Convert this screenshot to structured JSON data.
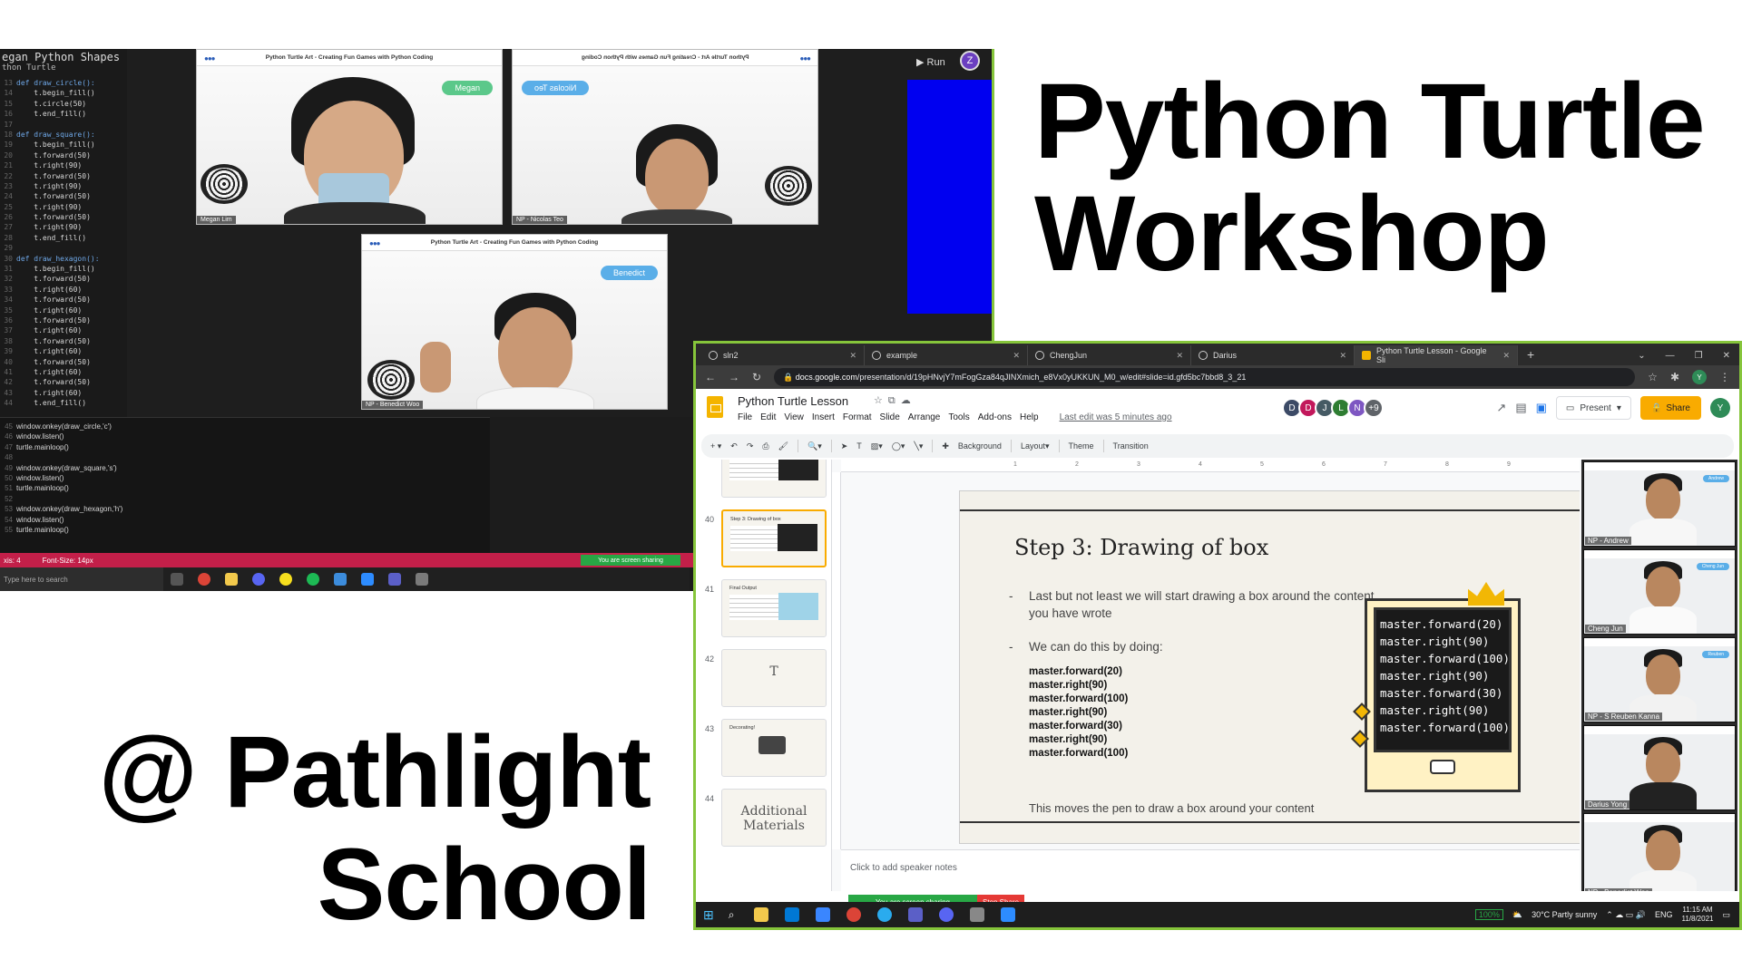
{
  "titles": {
    "main_line1": "Python Turtle",
    "main_line2": "Workshop",
    "location_line1": "@ Pathlight",
    "location_line2": "School"
  },
  "editor": {
    "file_title": "egan Python Shapes",
    "subtitle": "thon Turtle",
    "lines": [
      {
        "n": "13",
        "t": "def draw_circle():",
        "kw": true
      },
      {
        "n": "14",
        "t": "    t.begin_fill()"
      },
      {
        "n": "15",
        "t": "    t.circle(50)"
      },
      {
        "n": "16",
        "t": "    t.end_fill()"
      },
      {
        "n": "17",
        "t": ""
      },
      {
        "n": "18",
        "t": "def draw_square():",
        "kw": true
      },
      {
        "n": "19",
        "t": "    t.begin_fill()"
      },
      {
        "n": "20",
        "t": "    t.forward(50)"
      },
      {
        "n": "21",
        "t": "    t.right(90)"
      },
      {
        "n": "22",
        "t": "    t.forward(50)"
      },
      {
        "n": "23",
        "t": "    t.right(90)"
      },
      {
        "n": "24",
        "t": "    t.forward(50)"
      },
      {
        "n": "25",
        "t": "    t.right(90)"
      },
      {
        "n": "26",
        "t": "    t.forward(50)"
      },
      {
        "n": "27",
        "t": "    t.right(90)"
      },
      {
        "n": "28",
        "t": "    t.end_fill()"
      },
      {
        "n": "29",
        "t": ""
      },
      {
        "n": "30",
        "t": "def draw_hexagon():",
        "kw": true
      },
      {
        "n": "31",
        "t": "    t.begin_fill()"
      },
      {
        "n": "32",
        "t": "    t.forward(50)"
      },
      {
        "n": "33",
        "t": "    t.right(60)"
      },
      {
        "n": "34",
        "t": "    t.forward(50)"
      },
      {
        "n": "35",
        "t": "    t.right(60)"
      },
      {
        "n": "36",
        "t": "    t.forward(50)"
      },
      {
        "n": "37",
        "t": "    t.right(60)"
      },
      {
        "n": "38",
        "t": "    t.forward(50)"
      },
      {
        "n": "39",
        "t": "    t.right(60)"
      },
      {
        "n": "40",
        "t": "    t.forward(50)"
      },
      {
        "n": "41",
        "t": "    t.right(60)"
      },
      {
        "n": "42",
        "t": "    t.forward(50)"
      },
      {
        "n": "43",
        "t": "    t.right(60)"
      },
      {
        "n": "44",
        "t": "    t.end_fill()"
      }
    ],
    "lower_lines": [
      {
        "n": "45",
        "t": "window.onkey(draw_circle,'c')"
      },
      {
        "n": "46",
        "t": "window.listen()"
      },
      {
        "n": "47",
        "t": "turtle.mainloop()"
      },
      {
        "n": "48",
        "t": ""
      },
      {
        "n": "49",
        "t": "window.onkey(draw_square,'s')"
      },
      {
        "n": "50",
        "t": "window.listen()"
      },
      {
        "n": "51",
        "t": "turtle.mainloop()"
      },
      {
        "n": "52",
        "t": ""
      },
      {
        "n": "53",
        "t": "window.onkey(draw_hexagon,'h')"
      },
      {
        "n": "54",
        "t": "window.listen()"
      },
      {
        "n": "55",
        "t": "turtle.mainloop()"
      }
    ],
    "status_left": "xis: 4",
    "status_font": "Font-Size: 14px",
    "sharing": "You are screen sharing",
    "search_placeholder": "Type here to search",
    "run_label": "Run",
    "avatar_letter": "Z"
  },
  "video_tiles": {
    "header_text": "Python Turtle Art - Creating Fun Games with Python Coding",
    "header_text_mirrored": "Python Turtle Art - Creating Fun Games with Python Coding",
    "tile1_bubble": "Megan",
    "tile1_label": "Megan Lim",
    "tile2_bubble": "Nicolas Teo",
    "tile2_label": "NP - Nicolas Teo",
    "tile3_bubble": "Benedict",
    "tile3_label": "NP - Benedict Woo"
  },
  "browser": {
    "tabs": [
      {
        "label": "sln2"
      },
      {
        "label": "example"
      },
      {
        "label": "ChengJun"
      },
      {
        "label": "Darius"
      },
      {
        "label": "Python Turtle Lesson - Google Sli",
        "active": true
      }
    ],
    "url_domain": "docs.google.com",
    "url_path": "/presentation/d/19pHNvjY7mFogGza84qJINXmich_e8Vx0yUKKUN_M0_w/edit#slide=id.gfd5bc7bbd8_3_21"
  },
  "slides_app": {
    "doc_title": "Python Turtle Lesson",
    "menu": [
      "File",
      "Edit",
      "View",
      "Insert",
      "Format",
      "Slide",
      "Arrange",
      "Tools",
      "Add-ons",
      "Help"
    ],
    "last_edit": "Last edit was 5 minutes ago",
    "collaborators": [
      {
        "letter": "D",
        "color": "#3c4a66"
      },
      {
        "letter": "D",
        "color": "#c2185b"
      },
      {
        "letter": "J",
        "color": "#455a64"
      },
      {
        "letter": "L",
        "color": "#2e7d32"
      },
      {
        "letter": "N",
        "color": "#7e57c2"
      }
    ],
    "more_collab": "+9",
    "present_label": "Present",
    "share_label": "Share",
    "user_letter": "Y",
    "toolbar": {
      "background": "Background",
      "layout": "Layout",
      "theme": "Theme",
      "transition": "Transition"
    },
    "ruler_ticks": [
      "1",
      "2",
      "3",
      "4",
      "5",
      "6",
      "7",
      "8",
      "9"
    ],
    "speaker_notes": "Click to add speaker notes"
  },
  "filmstrip": [
    {
      "num": "",
      "title": "Step 2: Writing your name",
      "style": "lines-dark"
    },
    {
      "num": "40",
      "title": "Step 3: Drawing of box",
      "style": "lines-dark",
      "active": true
    },
    {
      "num": "41",
      "title": "Final Output",
      "style": "lines"
    },
    {
      "num": "42",
      "title": "",
      "style": "big",
      "big": "T"
    },
    {
      "num": "43",
      "title": "Decorating!",
      "style": "eye"
    },
    {
      "num": "44",
      "title": "",
      "style": "big",
      "big": "Additional Materials"
    }
  ],
  "slide": {
    "title": "Step 3: Drawing of box",
    "bullet1": "Last but not least we will start drawing a box around the content you have wrote",
    "bullet2": "We can do this by doing:",
    "code": [
      "master.forward(20)",
      "master.right(90)",
      "master.forward(100)",
      "master.right(90)",
      "master.forward(30)",
      "master.right(90)",
      "master.forward(100)"
    ],
    "footer": "This moves the pen to draw a box around your content",
    "screen_code": [
      "master.forward(20)",
      "master.right(90)",
      "master.forward(100)",
      "master.right(90)",
      "master.forward(30)",
      "master.right(90)",
      "master.forward(100)"
    ]
  },
  "participants": [
    {
      "name": "NP - Andrew",
      "shirt": "#f7f7f7",
      "bubble": "Andrew"
    },
    {
      "name": "Cheng Jun",
      "shirt": "#fafafa",
      "bubble": "Cheng Jun"
    },
    {
      "name": "NP - S Reuben Kanna",
      "shirt": "#f2f2f2",
      "bubble": "Reuben"
    },
    {
      "name": "Darius Yong",
      "shirt": "#222222",
      "bubble": ""
    },
    {
      "name": "NP - Benedict Woo",
      "shirt": "#f5f5f5",
      "bubble": ""
    }
  ],
  "share_bar": {
    "sharing": "You are screen sharing",
    "stop": "Stop Share"
  },
  "taskbar2": {
    "zoom": "100%",
    "weather": "30°C  Partly sunny",
    "lang": "ENG",
    "time": "11:15 AM",
    "date": "11/8/2021"
  },
  "colors": {
    "accent_green": "#86c53b",
    "status_red": "#c31f49",
    "slides_yellow": "#f9ab00",
    "canvas_blue": "#0000f0"
  }
}
